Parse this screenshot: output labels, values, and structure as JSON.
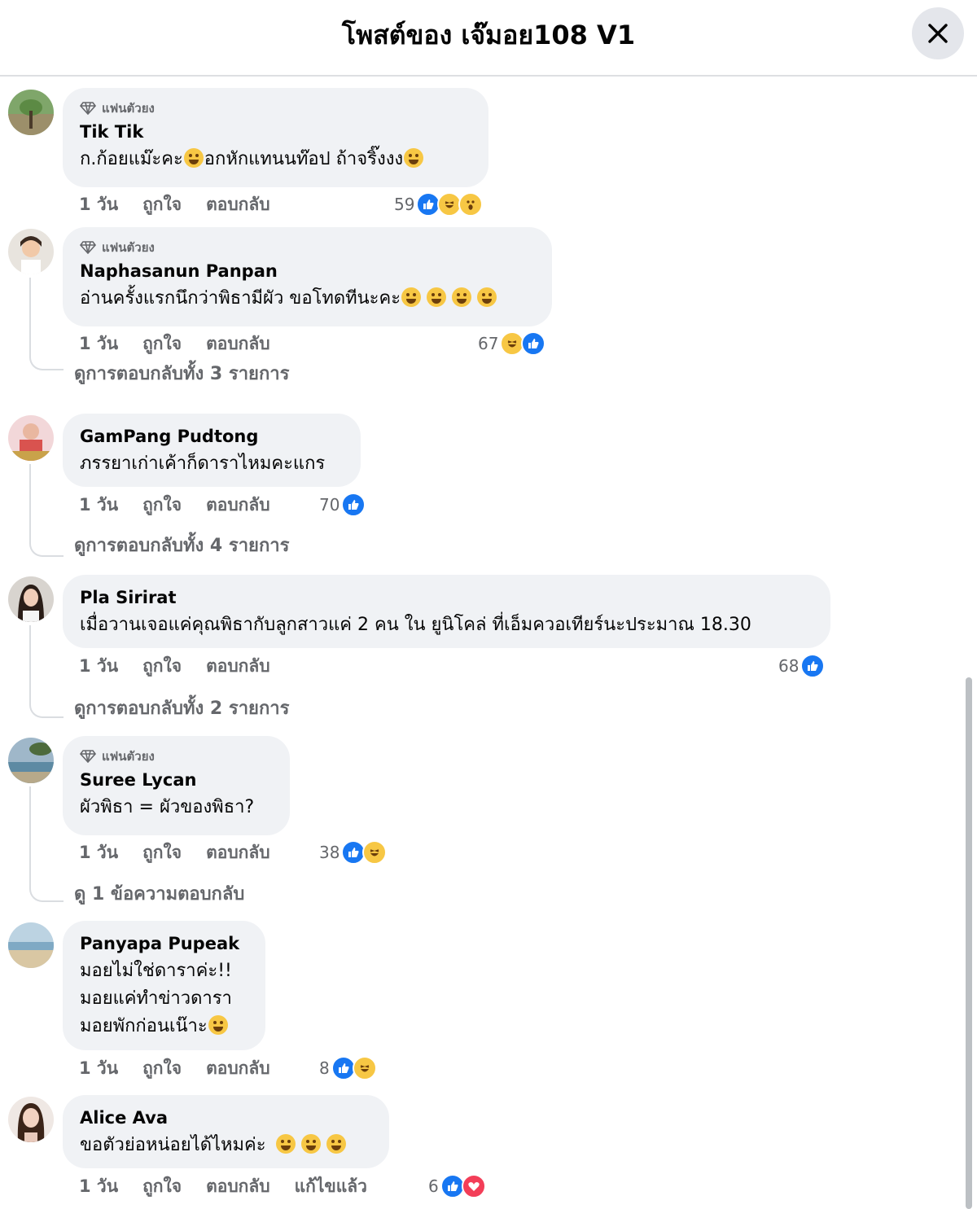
{
  "header": {
    "title": "โพสต์ของ เจ๊มอย108 V1"
  },
  "colors": {
    "like": "#1877f2",
    "bubble": "#f0f2f5",
    "secondary_text": "#65676b"
  },
  "comments": [
    {
      "badge": "แฟนตัวยง",
      "author": "Tik Tik",
      "text1": "ก.ก้อยแม๊ะคะ",
      "text2": "อกหักแทนนท๊อป ถ้าจริ๊งงง",
      "time": "1 วัน",
      "like": "ถูกใจ",
      "reply": "ตอบกลับ",
      "count": "59"
    },
    {
      "badge": "แฟนตัวยง",
      "author": "Naphasanun Panpan",
      "text": "อ่านครั้งแรกนึกว่าพิธามีผัว ขอโทดทีนะคะ",
      "time": "1 วัน",
      "like": "ถูกใจ",
      "reply": "ตอบกลับ",
      "count": "67",
      "view_replies": "ดูการตอบกลับทั้ง 3 รายการ"
    },
    {
      "author": "GamPang Pudtong",
      "text": "ภรรยาเก่าเค้าก็ดาราไหมคะแกร",
      "time": "1 วัน",
      "like": "ถูกใจ",
      "reply": "ตอบกลับ",
      "count": "70",
      "view_replies": "ดูการตอบกลับทั้ง 4 รายการ"
    },
    {
      "author": "Pla Sirirat",
      "text": "เมื่อวานเจอแค่คุณพิธากับลูกสาวแค่ 2 คน ใน ยูนิโคล่ ที่เอ็มควอเทียร์นะประมาณ 18.30",
      "time": "1 วัน",
      "like": "ถูกใจ",
      "reply": "ตอบกลับ",
      "count": "68",
      "view_replies": "ดูการตอบกลับทั้ง 2 รายการ"
    },
    {
      "badge": "แฟนตัวยง",
      "author": "Suree Lycan",
      "text": "ผัวพิธา = ผัวของพิธา?",
      "time": "1 วัน",
      "like": "ถูกใจ",
      "reply": "ตอบกลับ",
      "count": "38",
      "view_replies": "ดู 1 ข้อความตอบกลับ"
    },
    {
      "author": "Panyapa Pupeak",
      "line1": "มอยไม่ใช่ดาราค่ะ!!",
      "line2": "มอยแค่ทำข่าวดารา",
      "line3": "มอยพักก่อนเน๊าะ",
      "time": "1 วัน",
      "like": "ถูกใจ",
      "reply": "ตอบกลับ",
      "count": "8"
    },
    {
      "author": "Alice Ava",
      "text": "ขอตัวย่อหน่อยได้ไหมค่ะ",
      "time": "1 วัน",
      "like": "ถูกใจ",
      "reply": "ตอบกลับ",
      "edited": "แก้ไขแล้ว",
      "count": "6"
    }
  ]
}
